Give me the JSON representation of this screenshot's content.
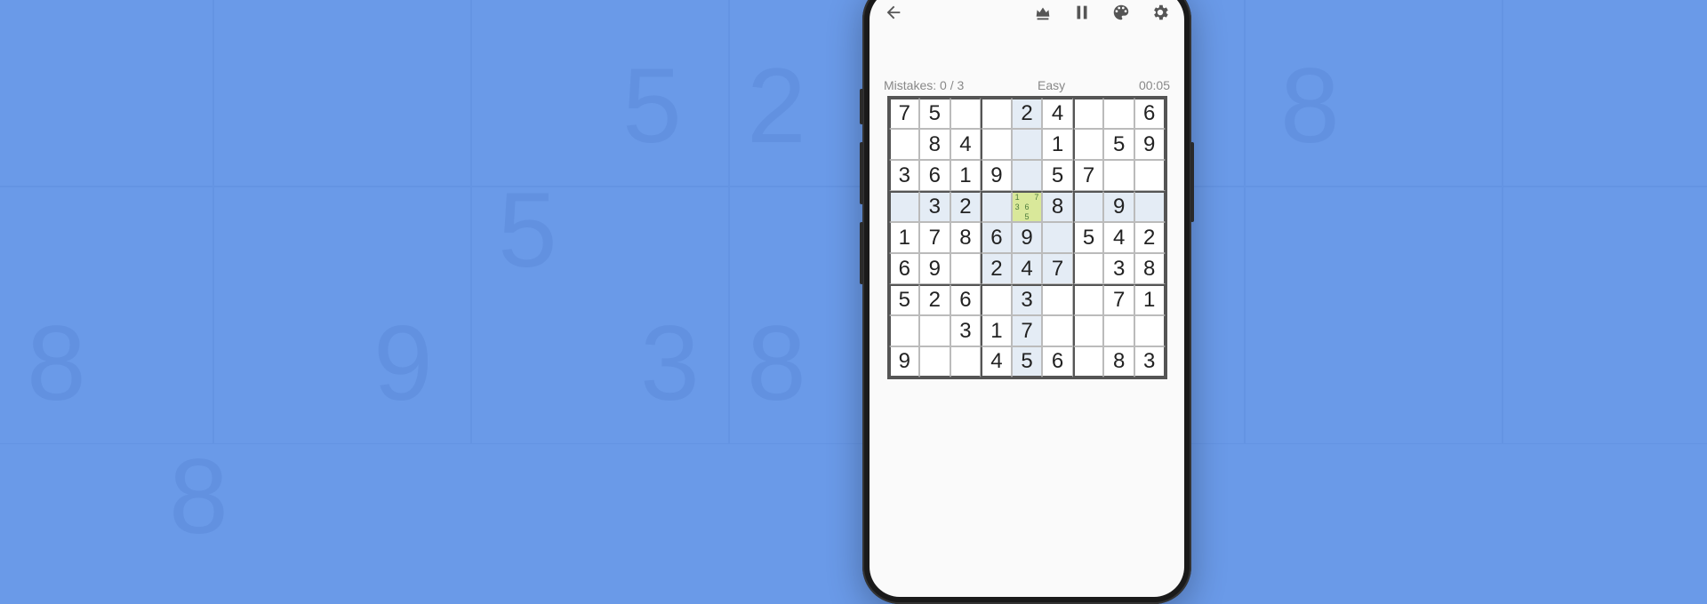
{
  "status": {
    "mistakes_label": "Mistakes: 0 / 3",
    "difficulty": "Easy",
    "time": "00:05"
  },
  "selected": {
    "row": 3,
    "col": 4
  },
  "pencil_marks": {
    "r3c4": [
      "1",
      "",
      "7",
      "3",
      "6",
      "",
      "",
      "5",
      ""
    ]
  },
  "grid": [
    [
      "7",
      "5",
      "",
      "",
      "2",
      "4",
      "",
      "",
      "6"
    ],
    [
      "",
      "8",
      "4",
      "",
      "",
      "1",
      "",
      "5",
      "9"
    ],
    [
      "3",
      "6",
      "1",
      "9",
      "",
      "5",
      "7",
      "",
      ""
    ],
    [
      "",
      "3",
      "2",
      "",
      "",
      "8",
      "",
      "9",
      ""
    ],
    [
      "1",
      "7",
      "8",
      "6",
      "9",
      "",
      "5",
      "4",
      "2"
    ],
    [
      "6",
      "9",
      "",
      "2",
      "4",
      "7",
      "",
      "3",
      "8"
    ],
    [
      "5",
      "2",
      "6",
      "",
      "3",
      "",
      "",
      "7",
      "1"
    ],
    [
      "",
      "",
      "3",
      "1",
      "7",
      "",
      "",
      "",
      ""
    ],
    [
      "9",
      "",
      "",
      "4",
      "5",
      "6",
      "",
      "8",
      "3"
    ]
  ]
}
